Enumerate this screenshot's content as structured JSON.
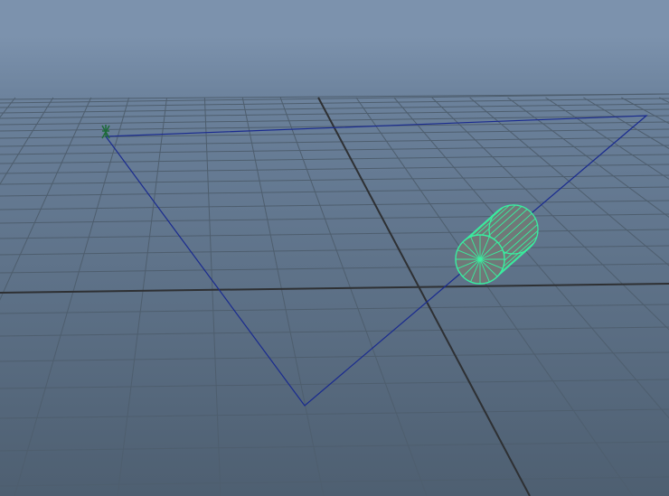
{
  "viewport": {
    "view": "perspective",
    "background_colors": [
      "#7c92ad",
      "#4e5f71"
    ],
    "grid": {
      "line_color": "#4e5e6e",
      "axis_color": "#2e3033"
    },
    "motion_path": {
      "color": "#1a2b8f",
      "shape": "closed triangle"
    },
    "selected_object": {
      "type": "cylinder",
      "wireframe_color": "#38f0a0",
      "body_color": "#707878"
    },
    "pivot_marker": {
      "icon": "locator-icon",
      "color": "#1e6a3a"
    }
  }
}
